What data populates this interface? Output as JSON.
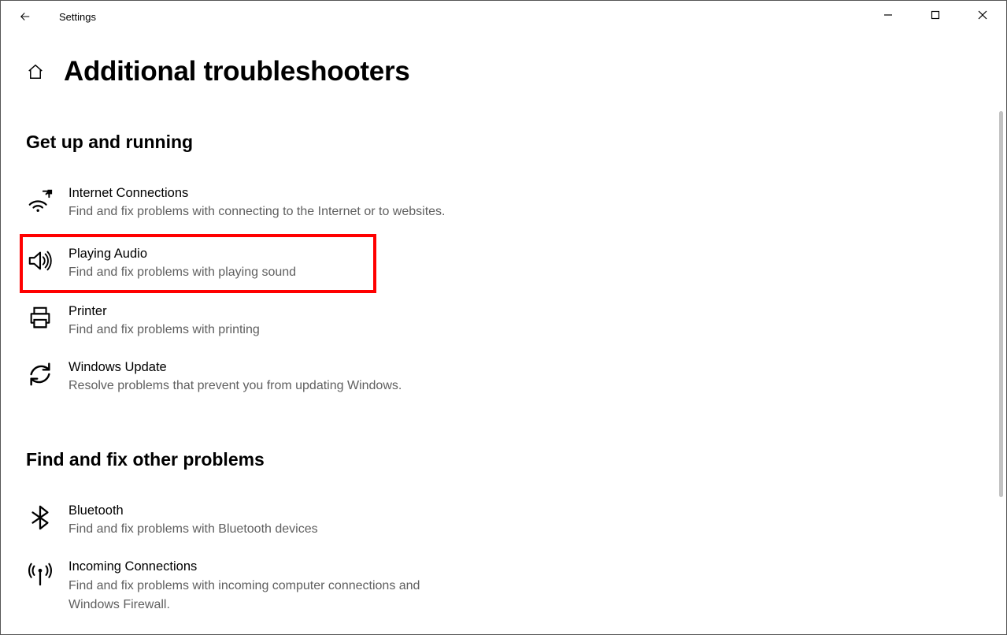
{
  "app_title": "Settings",
  "page_title": "Additional troubleshooters",
  "sections": [
    {
      "heading": "Get up and running",
      "items": [
        {
          "icon": "wifi-icon",
          "title": "Internet Connections",
          "desc": "Find and fix problems with connecting to the Internet or to websites.",
          "highlighted": false
        },
        {
          "icon": "speaker-icon",
          "title": "Playing Audio",
          "desc": "Find and fix problems with playing sound",
          "highlighted": true
        },
        {
          "icon": "printer-icon",
          "title": "Printer",
          "desc": "Find and fix problems with printing",
          "highlighted": false
        },
        {
          "icon": "update-icon",
          "title": "Windows Update",
          "desc": "Resolve problems that prevent you from updating Windows.",
          "highlighted": false
        }
      ]
    },
    {
      "heading": "Find and fix other problems",
      "items": [
        {
          "icon": "bluetooth-icon",
          "title": "Bluetooth",
          "desc": "Find and fix problems with Bluetooth devices",
          "highlighted": false
        },
        {
          "icon": "antenna-icon",
          "title": "Incoming Connections",
          "desc": "Find and fix problems with incoming computer connections and Windows Firewall.",
          "highlighted": false
        }
      ]
    }
  ]
}
